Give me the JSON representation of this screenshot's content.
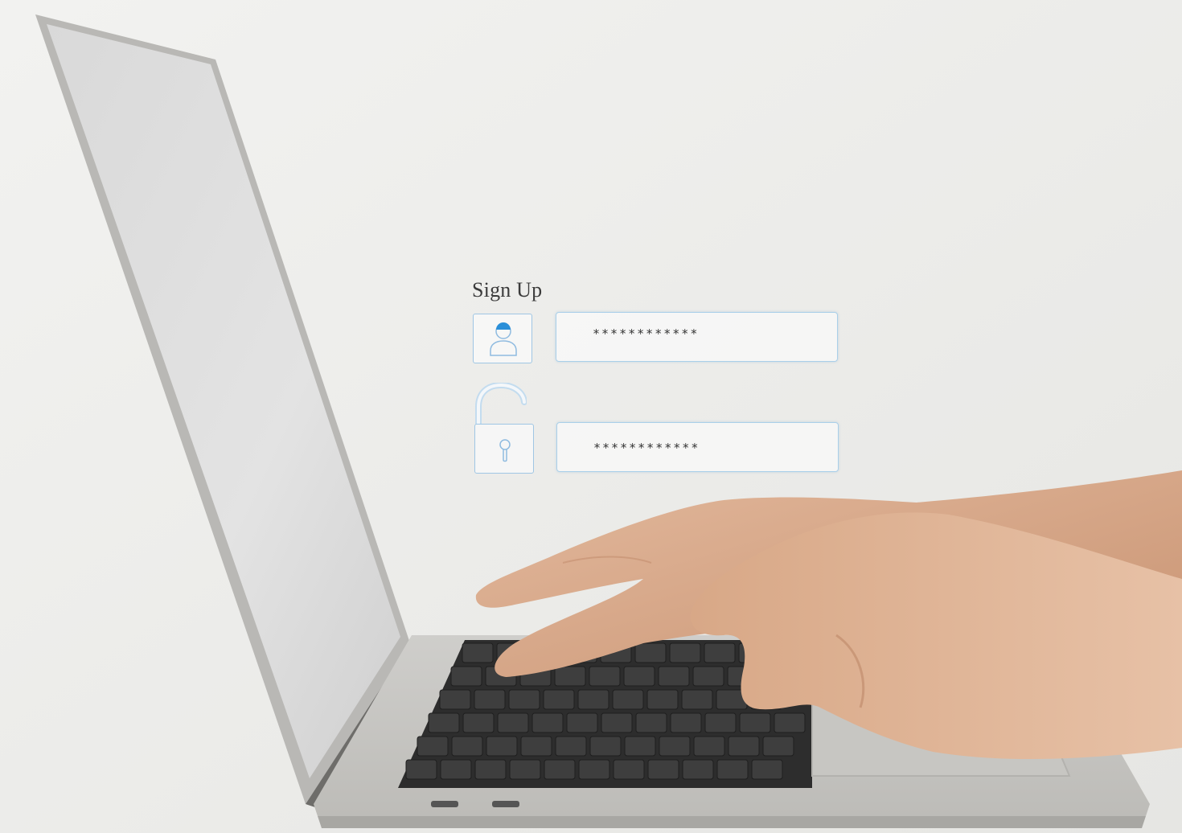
{
  "form": {
    "title": "Sign Up",
    "username_value": "************",
    "password_value": "************"
  },
  "icons": {
    "user": "user-icon",
    "lock": "unlocked-padlock-icon"
  },
  "colors": {
    "accent": "#2a8fd8",
    "field_border": "#a9cfe9",
    "background": "#efefed"
  }
}
